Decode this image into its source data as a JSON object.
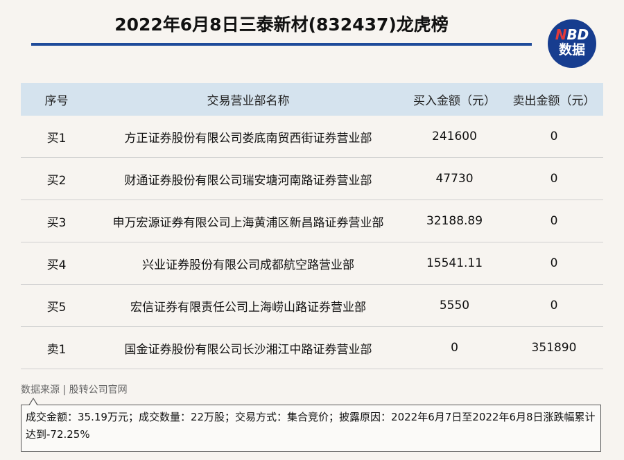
{
  "title": "2022年6月8日三泰新材(832437)龙虎榜",
  "logo": {
    "n": "N",
    "bd": "BD",
    "line2": "数据"
  },
  "colors": {
    "accent": "#1f4b9a",
    "logo_bg": "#173d8f",
    "logo_red": "#e23a3a",
    "header_bg": "#d5e3ee",
    "page_bg": "#f7f4f0"
  },
  "table": {
    "headers": [
      "序号",
      "交易营业部名称",
      "买入金额（元）",
      "卖出金额（元）"
    ],
    "rows": [
      [
        "买1",
        "方正证券股份有限公司娄底南贸西街证券营业部",
        "241600",
        "0"
      ],
      [
        "买2",
        "财通证券股份有限公司瑞安塘河南路证券营业部",
        "47730",
        "0"
      ],
      [
        "买3",
        "申万宏源证券有限公司上海黄浦区新昌路证券营业部",
        "32188.89",
        "0"
      ],
      [
        "买4",
        "兴业证券股份有限公司成都航空路营业部",
        "15541.11",
        "0"
      ],
      [
        "买5",
        "宏信证券有限责任公司上海崂山路证券营业部",
        "5550",
        "0"
      ],
      [
        "卖1",
        "国金证券股份有限公司长沙湘江中路证券营业部",
        "0",
        "351890"
      ]
    ]
  },
  "source": "数据来源 | 股转公司官网",
  "note": "成交金额：35.19万元；成交数量：22万股；交易方式：集合竞价；披露原因：2022年6月7日至2022年6月8日涨跌幅累计达到-72.25%"
}
